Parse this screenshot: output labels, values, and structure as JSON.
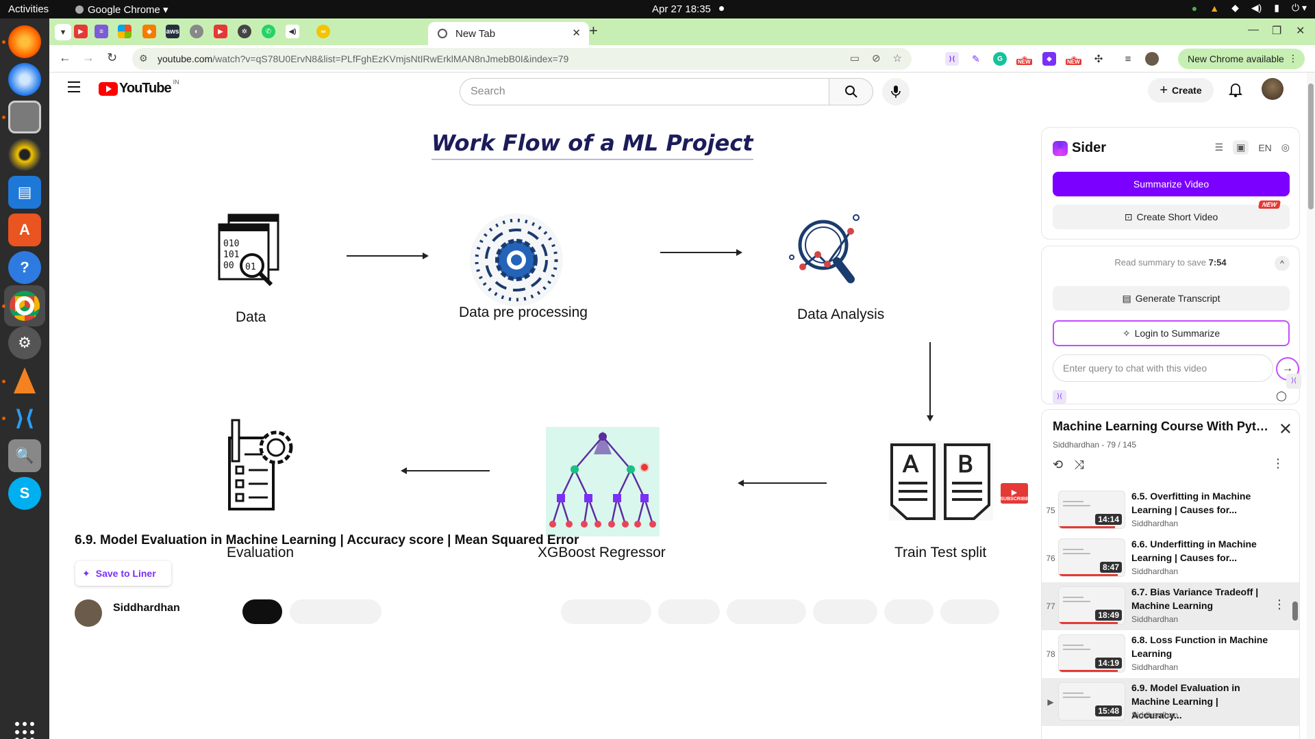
{
  "desktop": {
    "activities": "Activities",
    "app_name": "Google Chrome ▾",
    "clock": "Apr 27  18:35"
  },
  "dock": {
    "items": [
      "firefox-icon",
      "thunderbird-icon",
      "files-icon",
      "rhythmbox-icon",
      "writer-icon",
      "app-center-icon",
      "help-icon",
      "chrome-icon",
      "settings-icon",
      "vlc-icon",
      "vscode-icon",
      "magnifier-icon",
      "skype-icon"
    ]
  },
  "browser": {
    "active_tab_title": "New Tab",
    "url_host": "youtube.com",
    "url_path": "/watch?v=qS78U0ErvN8&list=PLfFghEzKVmjsNtIRwErklMAN8nJmebB0I&index=79",
    "update_button": "New Chrome available",
    "ext_new_badge": "NEW"
  },
  "youtube": {
    "logo_text": "YouTube",
    "country": "IN",
    "search_placeholder": "Search",
    "create_label": "Create"
  },
  "slide": {
    "title": "Work Flow of a ML Project",
    "steps": {
      "data": "Data",
      "preprocessing": "Data pre processing",
      "analysis": "Data Analysis",
      "split": "Train Test split",
      "model": "XGBoost Regressor",
      "evaluation": "Evaluation"
    },
    "subscribe": "SUBSCRIBE"
  },
  "video": {
    "title": "6.9. Model Evaluation in Machine Learning | Accuracy score | Mean Squared Error",
    "liner_label": "Save to Liner",
    "channel": "Siddhardhan"
  },
  "sider": {
    "brand": "Sider",
    "lang": "EN",
    "summarize": "Summarize Video",
    "short_video": "Create Short Video",
    "new_tag": "NEW",
    "save_prefix": "Read summary to save ",
    "save_time": "7:54",
    "transcript": "Generate Transcript",
    "login": "Login to Summarize",
    "chat_placeholder": "Enter query to chat with this video"
  },
  "playlist": {
    "title": "Machine Learning Course With Pyth...",
    "subtitle": "Siddhardhan - 79 / 145",
    "items": [
      {
        "index": "75",
        "title": "6.5. Overfitting in Machine Learning | Causes for...",
        "channel": "Siddhardhan",
        "duration": "14:14",
        "progress": 0.85
      },
      {
        "index": "76",
        "title": "6.6. Underfitting in Machine Learning | Causes for...",
        "channel": "Siddhardhan",
        "duration": "8:47",
        "progress": 0.9
      },
      {
        "index": "77",
        "title": "6.7. Bias Variance Tradeoff | Machine Learning",
        "channel": "Siddhardhan",
        "duration": "18:49",
        "progress": 0.9
      },
      {
        "index": "78",
        "title": "6.8. Loss Function in Machine Learning",
        "channel": "Siddhardhan",
        "duration": "14:19",
        "progress": 0.9
      },
      {
        "index": "▶",
        "title": "6.9. Model Evaluation in Machine Learning | Accuracy...",
        "channel": "Siddhardhan",
        "duration": "15:48",
        "progress": 0
      }
    ]
  }
}
